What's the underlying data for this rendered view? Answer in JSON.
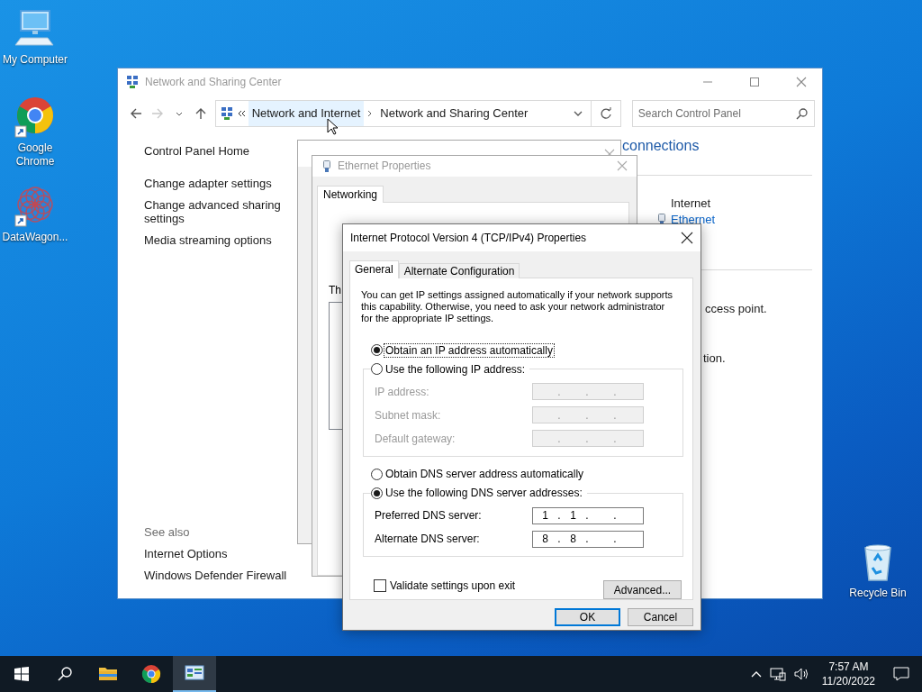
{
  "desktop_icons": [
    {
      "label": "My Computer",
      "kind": "computer",
      "shortcut": false
    },
    {
      "label": "Google Chrome",
      "kind": "chrome",
      "shortcut": true
    },
    {
      "label": "DataWagon...",
      "kind": "datawagon",
      "shortcut": true
    },
    {
      "label": "Recycle Bin",
      "kind": "recycle",
      "shortcut": false
    }
  ],
  "network_window": {
    "title": "Network and Sharing Center",
    "breadcrumb": [
      {
        "label": "Network and Internet",
        "hovered": true
      },
      {
        "label": "Network and Sharing Center",
        "hovered": false
      }
    ],
    "search": {
      "placeholder": "Search Control Panel"
    },
    "sidebar": {
      "home": "Control Panel Home",
      "links": [
        "Change adapter settings",
        "Change advanced sharing settings",
        "Media streaming options"
      ],
      "see_also": "See also",
      "see_also_links": [
        "Internet Options",
        "Windows Defender Firewall"
      ]
    },
    "main": {
      "heading_fragment": "connections",
      "access_type": "Internet",
      "connection_link": "Ethernet",
      "line_fragments": [
        "ccess point.",
        "tion."
      ]
    }
  },
  "ethernet_properties": {
    "title": "Ethernet Properties",
    "tabs": [
      {
        "label": "Networking",
        "selected": true
      }
    ],
    "text_fragment": "Th"
  },
  "ipv4_dialog": {
    "title": "Internet Protocol Version 4 (TCP/IPv4) Properties",
    "tabs": [
      {
        "label": "General",
        "selected": true
      },
      {
        "label": "Alternate Configuration",
        "selected": false
      }
    ],
    "intro": "You can get IP settings assigned automatically if your network supports this capability. Otherwise, you need to ask your network administrator for the appropriate IP settings.",
    "separator": ".",
    "ip_options": [
      {
        "label": "Obtain an IP address automatically",
        "selected": true,
        "focused": true
      },
      {
        "label": "Use the following IP address:",
        "selected": false,
        "focused": false
      }
    ],
    "ip_fields": [
      {
        "label": "IP address:",
        "disabled": true
      },
      {
        "label": "Subnet mask:",
        "disabled": true
      },
      {
        "label": "Default gateway:",
        "disabled": true
      }
    ],
    "dns_options": [
      {
        "label": "Obtain DNS server address automatically",
        "selected": false,
        "focused": false
      },
      {
        "label": "Use the following DNS server addresses:",
        "selected": true,
        "focused": false
      }
    ],
    "dns_fields": [
      {
        "label": "Preferred DNS server:",
        "disabled": false,
        "octets": [
          "1",
          "1"
        ]
      },
      {
        "label": "Alternate DNS server:",
        "disabled": false,
        "octets": [
          "8",
          "8"
        ]
      }
    ],
    "validate": {
      "label": "Validate settings upon exit",
      "checked": false
    },
    "advanced_button": "Advanced...",
    "buttons": [
      {
        "label": "OK",
        "default": true
      },
      {
        "label": "Cancel",
        "default": false
      }
    ]
  },
  "taskbar": {
    "apps": [
      {
        "kind": "explorer",
        "selected": false
      },
      {
        "kind": "chrome",
        "selected": false
      },
      {
        "kind": "network",
        "selected": true
      }
    ],
    "time": "7:57 AM",
    "date": "11/20/2022"
  }
}
